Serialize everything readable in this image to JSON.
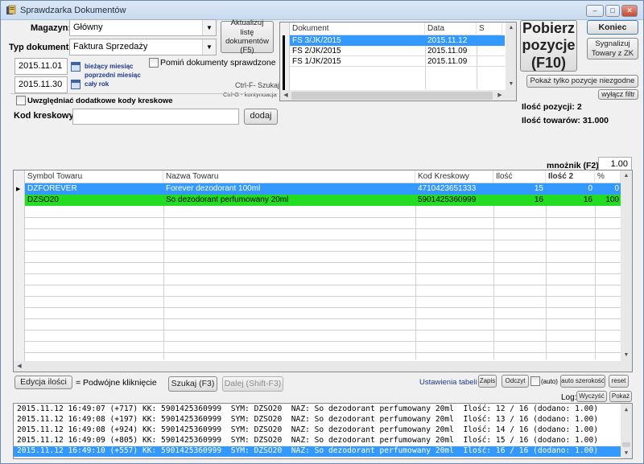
{
  "window": {
    "title": "Sprawdzarka Dokumentów",
    "controls": [
      "–",
      "□",
      "✕"
    ]
  },
  "form": {
    "magazyn_label": "Magazyn:",
    "magazyn_value": "Główny",
    "typ_label": "Typ dokumentu:",
    "typ_value": "Faktura Sprzedaży",
    "date_from": "2015.11.01",
    "date_to": "2015.11.30",
    "link_current_month": "bieżący miesiąc",
    "link_prev_month": "poprzedni miesiąc",
    "link_whole_year": "cały rok",
    "skip_checked_label": "Pomiń dokumenty sprawdzone",
    "extra_barcodes_label": "Uwzględniać dodatkowe kody kreskowe",
    "barcode_label": "Kod kreskowy:",
    "barcode_value": "",
    "add_button": "dodaj",
    "refresh_button": "Aktualizuj listę dokumentów (F5)",
    "search_hint": "Ctrl-F- Szukaj",
    "search_hint2": "Ctrl-G - kontynuacja"
  },
  "documents": {
    "headers": [
      "Dokument",
      "Data",
      "S"
    ],
    "rows": [
      {
        "doc": "FS 3/JK/2015",
        "date": "2015.11.12",
        "s": ""
      },
      {
        "doc": "FS 2/JK/2015",
        "date": "2015.11.09",
        "s": ""
      },
      {
        "doc": "FS 1/JK/2015",
        "date": "2015.11.09",
        "s": ""
      }
    ]
  },
  "right": {
    "fetch_button": "Pobierz pozycje (F10)",
    "end_button": "Koniec",
    "signal_button": "Sygnalizuj Towary z ZK",
    "mismatch_button": "Pokaż tylko pozycje niezgodne",
    "filter_off_button": "wyłącz filtr",
    "positions_count": "Ilość pozycji: 2",
    "goods_count": "Ilość towarów: 31.000",
    "multiplier_label": "mnożnik (F2):",
    "multiplier_value": "1.00"
  },
  "items": {
    "headers": [
      "Symbol Towaru",
      "Nazwa Towaru",
      "Kod Kreskowy",
      "Ilość",
      "Ilość 2",
      "%"
    ],
    "rows": [
      {
        "symbol": "DZFOREVER",
        "name": "Forever dezodorant 100ml",
        "barcode": "4710423651333",
        "qty": "15",
        "qty2": "0",
        "pct": "0",
        "state": "selected"
      },
      {
        "symbol": "DZSO20",
        "name": "So dezodorant perfumowany 20ml",
        "barcode": "5901425360999",
        "qty": "16",
        "qty2": "16",
        "pct": "100",
        "state": "ok"
      }
    ]
  },
  "bottom": {
    "edit_qty_button": "Edycja ilości",
    "double_click_hint": "= Podwójne kliknięcie",
    "search_button": "Szukaj (F3)",
    "next_button": "Dalej (Shift-F3)",
    "table_settings_label": "Ustawienia tabeli",
    "save_button": "Zapis",
    "read_button": "Odczyt",
    "auto_label": "(auto)",
    "auto_width_button": "auto szerokość",
    "reset_button": "reset",
    "log_label": "Log:",
    "clear_button": "Wyczyść",
    "show_button": "Pokaż"
  },
  "log": [
    "2015.11.12 16:49:07 (+717) KK: 5901425360999  SYM: DZSO20  NAZ: So dezodorant perfumowany 20ml  Ilość: 12 / 16 (dodano: 1.00)",
    "2015.11.12 16:49:08 (+197) KK: 5901425360999  SYM: DZSO20  NAZ: So dezodorant perfumowany 20ml  Ilość: 13 / 16 (dodano: 1.00)",
    "2015.11.12 16:49:08 (+924) KK: 5901425360999  SYM: DZSO20  NAZ: So dezodorant perfumowany 20ml  Ilość: 14 / 16 (dodano: 1.00)",
    "2015.11.12 16:49:09 (+805) KK: 5901425360999  SYM: DZSO20  NAZ: So dezodorant perfumowany 20ml  Ilość: 15 / 16 (dodano: 1.00)",
    "2015.11.12 16:49:10 (+557) KK: 5901425360999  SYM: DZSO20  NAZ: So dezodorant perfumowany 20ml  Ilość: 16 / 16 (dodano: 1.00)"
  ],
  "colors": {
    "selected_row": "#3399ff",
    "ok_row": "#22dd22",
    "link": "#1f3b8a"
  }
}
